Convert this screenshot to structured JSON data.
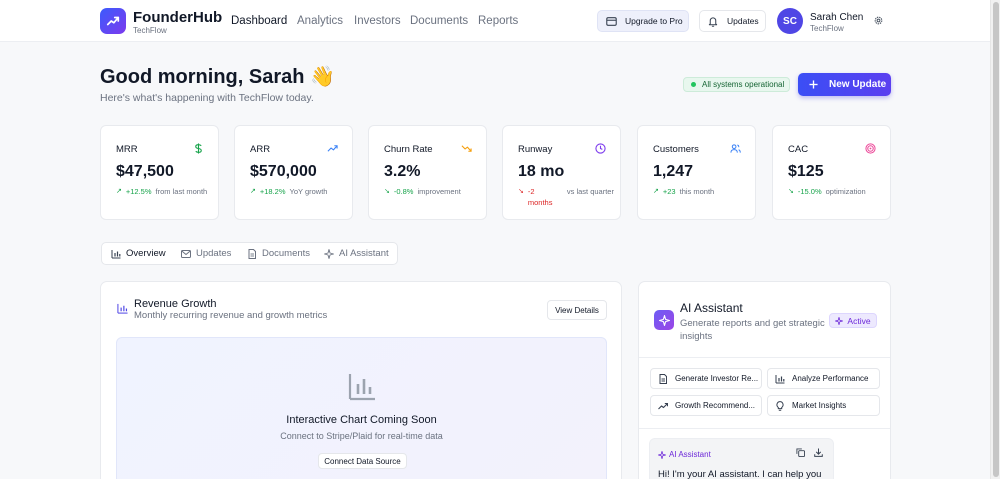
{
  "header": {
    "brand": "FounderHub",
    "company": "TechFlow",
    "nav": [
      "Dashboard",
      "Analytics",
      "Investors",
      "Documents",
      "Reports"
    ],
    "upgrade_label": "Upgrade to Pro",
    "updates_label": "Updates",
    "user": {
      "initials": "SC",
      "name": "Sarah Chen",
      "company": "TechFlow"
    }
  },
  "greeting": {
    "title": "Good morning, Sarah 👋",
    "subtitle": "Here's what's happening with TechFlow today."
  },
  "status": {
    "label": "All systems operational",
    "color": "#22c55e"
  },
  "new_update_label": "New Update",
  "kpis": [
    {
      "label": "MRR",
      "value": "$47,500",
      "arrow": "↗",
      "delta": "+12.5%",
      "note": "from last month",
      "trend": "pos",
      "icon": "dollar-icon",
      "icon_color": "#16a34a"
    },
    {
      "label": "ARR",
      "value": "$570,000",
      "arrow": "↗",
      "delta": "+18.2%",
      "note": "YoY growth",
      "trend": "pos",
      "icon": "trending-up-icon",
      "icon_color": "#3b82f6"
    },
    {
      "label": "Churn Rate",
      "value": "3.2%",
      "arrow": "↘",
      "delta": "-0.8%",
      "note": "improvement",
      "trend": "pos",
      "icon": "trending-down-icon",
      "icon_color": "#f59e0b"
    },
    {
      "label": "Runway",
      "value": "18 mo",
      "arrow": "↘",
      "delta": "-2 months",
      "note": "vs last quarter",
      "trend": "neg",
      "icon": "clock-icon",
      "icon_color": "#7c3aed"
    },
    {
      "label": "Customers",
      "value": "1,247",
      "arrow": "↗",
      "delta": "+23",
      "note": "this month",
      "trend": "pos",
      "icon": "users-icon",
      "icon_color": "#3b82f6"
    },
    {
      "label": "CAC",
      "value": "$125",
      "arrow": "↘",
      "delta": "-15.0%",
      "note": "optimization",
      "trend": "pos",
      "icon": "target-icon",
      "icon_color": "#ec4899"
    }
  ],
  "tabs": [
    "Overview",
    "Updates",
    "Documents",
    "AI Assistant"
  ],
  "revenue": {
    "title": "Revenue Growth",
    "subtitle": "Monthly recurring revenue and growth metrics",
    "view_details": "View Details",
    "placeholder_title": "Interactive Chart Coming Soon",
    "placeholder_subtitle": "Connect to Stripe/Plaid for real-time data",
    "connect_label": "Connect Data Source"
  },
  "ai": {
    "title": "AI Assistant",
    "subtitle": "Generate reports and get strategic insights",
    "badge": "Active",
    "actions": [
      "Generate Investor Re...",
      "Analyze Performance",
      "Growth Recommend...",
      "Market Insights"
    ],
    "chat_label": "AI Assistant",
    "chat_text": "Hi! I'm your AI assistant. I can help you"
  }
}
